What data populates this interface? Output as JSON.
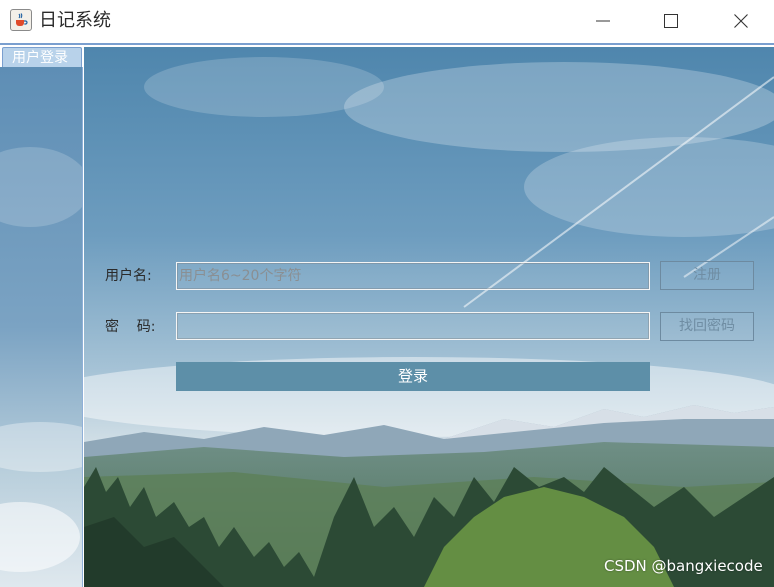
{
  "window": {
    "title": "日记系统",
    "app_icon": "java-coffee-cup-icon",
    "controls": {
      "minimize": "minimize-icon",
      "maximize": "maximize-icon",
      "close": "close-icon"
    }
  },
  "tabs": [
    {
      "label": "用户登录",
      "selected": true
    }
  ],
  "form": {
    "username_label": "用户名:",
    "username_placeholder": "用户名6~20个字符",
    "password_label": "密    码:",
    "password_value": "",
    "register_button": "注册",
    "recover_button": "找回密码",
    "login_button": "登录"
  },
  "colors": {
    "login_button": "#5d8fa8",
    "tab_background": "#b8d2ea",
    "titlebar_accent": "#7a9fcf"
  },
  "watermark": "CSDN @bangxiecode"
}
